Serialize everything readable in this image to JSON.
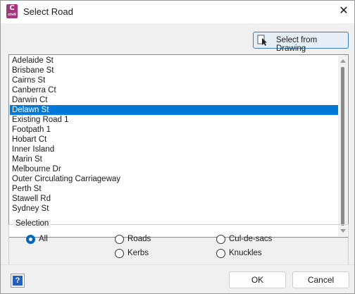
{
  "window": {
    "title": "Select Road",
    "app_icon_letter": "C",
    "app_icon_sub": "civil",
    "close_glyph": "✕"
  },
  "toolbar": {
    "select_from_drawing_label": "Select from Drawing",
    "select_icon": "pick-cursor-icon"
  },
  "roads": {
    "items": [
      "Adelaide St",
      "Brisbane St",
      "Cairns St",
      "Canberra Ct",
      "Darwin Ct",
      "Delawn St",
      "Existing Road 1",
      "Footpath 1",
      "Hobart Ct",
      "Inner Island",
      "Marin St",
      "Melbourne Dr",
      "Outer Circulating Carriageway",
      "Perth St",
      "Stawell Rd",
      "Sydney St"
    ],
    "selected_index": 5
  },
  "selection": {
    "title": "Selection",
    "options": [
      "All",
      "Roads",
      "Cul-de-sacs",
      "Kerbs",
      "Knuckles"
    ],
    "checked": "All"
  },
  "footer": {
    "help_glyph": "?",
    "ok_label": "OK",
    "cancel_label": "Cancel"
  },
  "colors": {
    "selection_highlight": "#0078d7",
    "app_icon": "#a4357d",
    "accent_border": "#3d7ab8"
  }
}
